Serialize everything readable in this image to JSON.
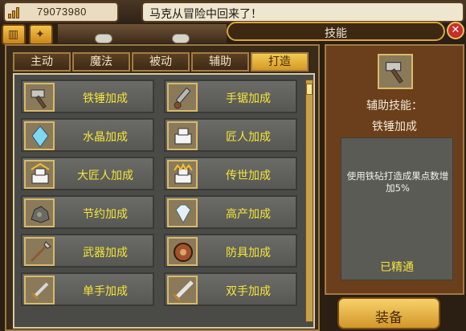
{
  "topbar": {
    "gold_value": "79073980",
    "message": "马克从冒险中回来了！"
  },
  "header": {
    "title": "技能"
  },
  "tabs": [
    {
      "label": "主动",
      "active": false
    },
    {
      "label": "魔法",
      "active": false
    },
    {
      "label": "被动",
      "active": false
    },
    {
      "label": "辅助",
      "active": false
    },
    {
      "label": "打造",
      "active": true
    }
  ],
  "skills": [
    {
      "label": "铁锤加成",
      "icon": "hammer-icon"
    },
    {
      "label": "手锯加成",
      "icon": "saw-icon"
    },
    {
      "label": "水晶加成",
      "icon": "crystal-icon"
    },
    {
      "label": "匠人加成",
      "icon": "craftsman-icon"
    },
    {
      "label": "大匠人加成",
      "icon": "master-craftsman-icon"
    },
    {
      "label": "传世加成",
      "icon": "legend-icon"
    },
    {
      "label": "节约加成",
      "icon": "ore-icon"
    },
    {
      "label": "高产加成",
      "icon": "diamond-icon"
    },
    {
      "label": "武器加成",
      "icon": "spear-icon"
    },
    {
      "label": "防具加成",
      "icon": "shield-icon"
    },
    {
      "label": "单手加成",
      "icon": "sword-icon"
    },
    {
      "label": "双手加成",
      "icon": "greatsword-icon"
    }
  ],
  "detail": {
    "type_label": "辅助技能：",
    "skill_name": "铁锤加成",
    "description": "使用铁砧打造成果点数增加5%",
    "status": "已精通",
    "icon": "hammer-icon"
  },
  "equip_button": {
    "label": "装备"
  },
  "colors": {
    "accent_gold": "#f2cb52",
    "skill_text": "#f5e63a",
    "panel_brown": "#6b3f1b",
    "close_red": "#c5302a"
  }
}
